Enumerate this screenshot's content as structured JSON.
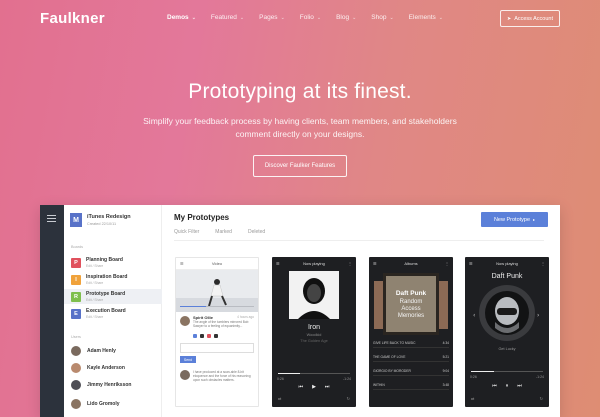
{
  "brand": "Faulkner",
  "nav": {
    "items": [
      {
        "label": "Demos",
        "active": true
      },
      {
        "label": "Featured"
      },
      {
        "label": "Pages"
      },
      {
        "label": "Folio"
      },
      {
        "label": "Blog"
      },
      {
        "label": "Shop"
      },
      {
        "label": "Elements"
      }
    ],
    "account": "Access Account"
  },
  "hero": {
    "title": "Prototyping at its finest.",
    "subtitle": "Simplify your feedback process by having clients, team members, and stakeholders comment directly on your designs.",
    "cta": "Discover Faulker Features"
  },
  "app": {
    "project": {
      "initial": "M",
      "title": "iTunes Redesign",
      "date": "Created 22/10/11"
    },
    "boards_label": "Boards",
    "boards": [
      {
        "initial": "P",
        "name": "Planning Board",
        "sub": "Edit / Share",
        "color": "#e0515d"
      },
      {
        "initial": "I",
        "name": "Inspiration Board",
        "sub": "Edit / Share",
        "color": "#f0a23b"
      },
      {
        "initial": "R",
        "name": "Prototype Board",
        "sub": "Edit / Share",
        "color": "#7fbf4d"
      },
      {
        "initial": "E",
        "name": "Execution Board",
        "sub": "Edit / Share",
        "color": "#5872c8"
      }
    ],
    "users_label": "Users",
    "users": [
      {
        "name": "Adam Henly",
        "color": "#7a6a5e"
      },
      {
        "name": "Kayle Anderson",
        "color": "#b98a6e"
      },
      {
        "name": "Jimmy Henriksson",
        "color": "#4e4e55"
      },
      {
        "name": "Lido Gromoly",
        "color": "#8a7462"
      }
    ],
    "main_title": "My Prototypes",
    "tabs": [
      "Quick Filter",
      "Marked",
      "Deleted"
    ],
    "new_button": "New Prototype",
    "cards": [
      {
        "header": "Video",
        "comment_author": "Spirit Ollie",
        "comment_time": "4 hours ago",
        "comment_text": "The angle of the tumblers mirrored Bob Sawyer to a feeling of equanimity...",
        "send_label": "Send",
        "comment2_text": "I have produced at a scan-able 8-bit eloquence and the force of his reasoning upon such obstacles matters."
      },
      {
        "header": "Now playing",
        "song": "Iron",
        "artist": "Woodkid",
        "sub": "The Golden Age",
        "time_start": "0:26",
        "time_end": "-1:24",
        "progress": 0.3
      },
      {
        "header": "Albums",
        "album_title": "Daft Punk",
        "album_sub": "Random Access Memories",
        "tracks": [
          {
            "name": "GIVE LIFE BACK TO MUSIC",
            "dur": "4:34"
          },
          {
            "name": "THE GAME OF LOVE",
            "dur": "5:21"
          },
          {
            "name": "GIORGIO BY MORODER",
            "dur": "9:04"
          },
          {
            "name": "WITHIN",
            "dur": "3:48"
          }
        ]
      },
      {
        "header": "Now playing",
        "song": "Daft Punk",
        "sub": "Get Lucky",
        "time_start": "0:26",
        "time_end": "-1:24",
        "progress": 0.32
      }
    ]
  },
  "colors": {
    "accent": "#5b80d9",
    "rail": "#2c323c",
    "gradient_start": "#e2708f",
    "gradient_end": "#de8d73"
  }
}
